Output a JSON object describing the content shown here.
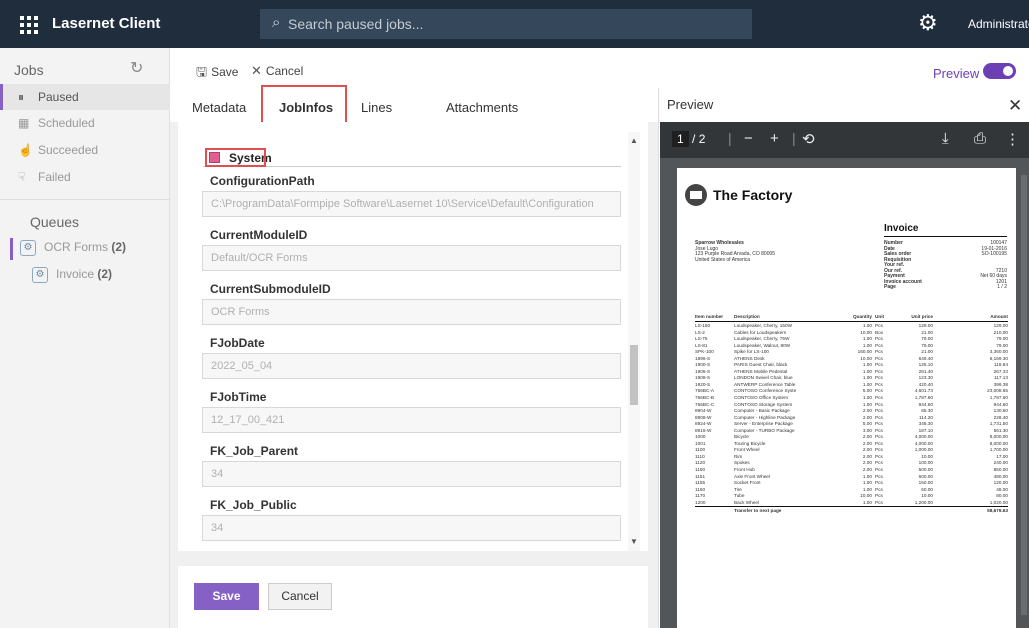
{
  "header": {
    "app_title": "Lasernet Client",
    "search_placeholder": "Search paused jobs...",
    "user": "Administrator"
  },
  "sidebar": {
    "jobs_heading": "Jobs",
    "items": [
      {
        "label": "Paused",
        "icon": "pause-icon"
      },
      {
        "label": "Scheduled",
        "icon": "calendar-icon"
      },
      {
        "label": "Succeeded",
        "icon": "thumbs-up-icon"
      },
      {
        "label": "Failed",
        "icon": "thumbs-down-icon"
      }
    ],
    "queues_heading": "Queues",
    "queues": [
      {
        "label": "OCR Forms",
        "count": "(2)"
      },
      {
        "label": "Invoice",
        "count": "(2)"
      }
    ]
  },
  "toolbar": {
    "save": "Save",
    "cancel": "Cancel",
    "preview": "Preview"
  },
  "tabs": [
    "Metadata",
    "JobInfos",
    "Lines",
    "Attachments"
  ],
  "form": {
    "section": "System",
    "fields": [
      {
        "label": "ConfigurationPath",
        "value": "C:\\ProgramData\\Formpipe Software\\Lasernet 10\\Service\\Default\\Configuration"
      },
      {
        "label": "CurrentModuleID",
        "value": "Default/OCR Forms"
      },
      {
        "label": "CurrentSubmoduleID",
        "value": "OCR Forms"
      },
      {
        "label": "FJobDate",
        "value": "2022_05_04"
      },
      {
        "label": "FJobTime",
        "value": "12_17_00_421"
      },
      {
        "label": "FK_Job_Parent",
        "value": "34"
      },
      {
        "label": "FK_Job_Public",
        "value": "34"
      }
    ]
  },
  "footer": {
    "save": "Save",
    "cancel": "Cancel"
  },
  "preview": {
    "title": "Preview",
    "page_current": "1",
    "page_total": "/ 2",
    "doc": {
      "company": "The Factory",
      "title": "Invoice",
      "customer": [
        "Sparrow Wholesales",
        "Jose Lugo",
        "123 Purple Road Arvada, CO 80005",
        "United States of America"
      ],
      "meta": [
        {
          "k": "Number",
          "v": "100147"
        },
        {
          "k": "Date",
          "v": "19-01-2016"
        },
        {
          "k": "Sales order",
          "v": "SO-100195"
        },
        {
          "k": "Requisition",
          "v": ""
        },
        {
          "k": "Your ref.",
          "v": ""
        },
        {
          "k": "Our ref.",
          "v": "7210"
        },
        {
          "k": "Payment",
          "v": "Net 60 days"
        },
        {
          "k": "Invoice account",
          "v": "1201"
        },
        {
          "k": "Page",
          "v": "1 / 2"
        }
      ],
      "columns": [
        "Item number",
        "Description",
        "Quantity",
        "Unit",
        "Unit price",
        "Amount"
      ],
      "rows": [
        [
          "LS-150",
          "Loudspeaker, Cherry, 150W",
          "1.00",
          "Pcs",
          "129.00",
          "129.00"
        ],
        [
          "LS-2",
          "Cables for Loudspeakers",
          "10.00",
          "Box",
          "21.00",
          "210.00"
        ],
        [
          "LS-75",
          "Loudspeaker, Cherry, 75W",
          "1.00",
          "Pcs",
          "79.00",
          "79.00"
        ],
        [
          "LS-81",
          "Loudspeaker, Walnut, 80W",
          "1.00",
          "Pcs",
          "79.00",
          "79.00"
        ],
        [
          "SPK-100",
          "Spike for LS-100",
          "160.00",
          "Pcs",
          "21.00",
          "3,360.00"
        ],
        [
          "1896-S",
          "ATHENS Desk",
          "10.00",
          "Pcs",
          "649.40",
          "6,169.30"
        ],
        [
          "1900-S",
          "PARIS Guest Chair, black",
          "1.00",
          "Pcs",
          "125.10",
          "118.84"
        ],
        [
          "1906-S",
          "ATHENS Mobile Pedestal",
          "1.00",
          "Pcs",
          "281.40",
          "267.33"
        ],
        [
          "1908-S",
          "LONDON Swivel Chair, blue",
          "1.00",
          "Pcs",
          "123.30",
          "117.13"
        ],
        [
          "1920-S",
          "ANTWERP Conference Table",
          "1.00",
          "Pcs",
          "420.40",
          "399.38"
        ],
        [
          "766BC-A",
          "CONTOSO Conference Syste",
          "5.00",
          "Pcs",
          "4,601.73",
          "23,008.65"
        ],
        [
          "766BC-B",
          "CONTOSO Office System",
          "1.00",
          "Pcs",
          "1,787.60",
          "1,787.60"
        ],
        [
          "766BC-C",
          "CONTOSO Storage System",
          "1.00",
          "Pcs",
          "944.60",
          "944.60"
        ],
        [
          "8904-W",
          "Computer - Basic Package",
          "2.00",
          "Pcs",
          "65.30",
          "130.60"
        ],
        [
          "8908-W",
          "Computer - Highline Package",
          "2.00",
          "Pcs",
          "114.20",
          "228.40"
        ],
        [
          "8924-W",
          "Server - Enterprise Package",
          "5.00",
          "Pcs",
          "346.30",
          "1,731.50"
        ],
        [
          "8916-W",
          "Computer - TURBO Package",
          "3.00",
          "Pcs",
          "187.10",
          "561.30"
        ],
        [
          "1000",
          "Bicycle",
          "2.00",
          "Pcs",
          "4,000.00",
          "8,000.00"
        ],
        [
          "1001",
          "Touring Bicycle",
          "2.00",
          "Pcs",
          "4,000.00",
          "8,000.00"
        ],
        [
          "1100",
          "Front Wheel",
          "2.00",
          "Pcs",
          "1,000.00",
          "1,700.00"
        ],
        [
          "1110",
          "Rim",
          "2.00",
          "Pcs",
          "10.00",
          "17.00"
        ],
        [
          "1120",
          "Spokes",
          "2.00",
          "Pcs",
          "100.00",
          "240.00"
        ],
        [
          "1150",
          "Front Hub",
          "2.00",
          "Pcs",
          "500.00",
          "850.00"
        ],
        [
          "1151",
          "Axle Front Wheel",
          "1.00",
          "Pcs",
          "600.00",
          "480.00"
        ],
        [
          "1155",
          "Socket Front",
          "1.00",
          "Pcs",
          "150.00",
          "120.00"
        ],
        [
          "1160",
          "Tire",
          "1.00",
          "Pcs",
          "60.00",
          "48.00"
        ],
        [
          "1170",
          "Tube",
          "10.00",
          "Pcs",
          "10.00",
          "80.00"
        ],
        [
          "1200",
          "Back Wheel",
          "1.00",
          "Pcs",
          "1,200.00",
          "1,020.00"
        ]
      ],
      "total_label": "Transfer to next page",
      "total_value": "58,676.63"
    }
  },
  "colors": {
    "accent": "#8661c5",
    "topbar": "#1f2d3d",
    "highlight": "#e05050"
  }
}
